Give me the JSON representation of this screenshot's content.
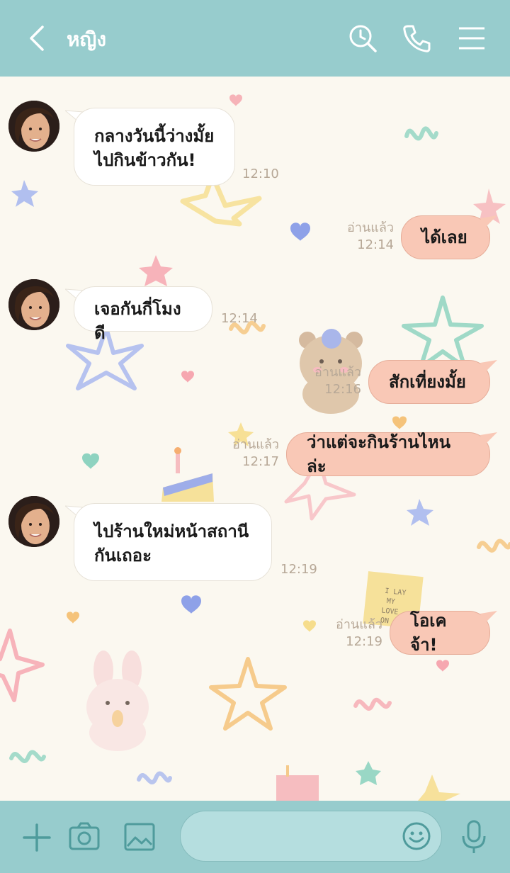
{
  "header": {
    "title": "หญิง"
  },
  "messages": [
    {
      "dir": "in",
      "text_lines": [
        "กลางวันนี้ว่างมั้ย",
        "ไปกินข้าวกัน!"
      ],
      "time": "12:10"
    },
    {
      "dir": "out",
      "text": "ได้เลย",
      "read": "อ่านแล้ว",
      "time": "12:14"
    },
    {
      "dir": "in",
      "text": "เจอกันกี่โมงดี",
      "time": "12:14"
    },
    {
      "dir": "out",
      "text": "สักเที่ยงมั้ย",
      "read": "อ่านแล้ว",
      "time": "12:16"
    },
    {
      "dir": "out",
      "text": "ว่าแต่จะกินร้านไหนล่ะ",
      "read": "อ่านแล้ว",
      "time": "12:17"
    },
    {
      "dir": "in",
      "text_lines": [
        "ไปร้านใหม่หน้าสถานี",
        "กันเถอะ"
      ],
      "time": "12:19"
    },
    {
      "dir": "out",
      "text": "โอเคจ้า!",
      "read": "อ่านแล้ว",
      "time": "12:19"
    }
  ],
  "colors": {
    "header_bg": "#97cccd",
    "chat_bg": "#fbf8f0",
    "incoming_bubble": "#ffffff",
    "outgoing_bubble": "#f9c8b6",
    "input_bar_bg": "#97cccd",
    "input_icon": "#4f9b9c"
  },
  "icons": {
    "back": "chevron-left-icon",
    "search": "clock-search-icon",
    "call": "phone-icon",
    "menu": "hamburger-menu-icon",
    "add": "plus-icon",
    "camera": "camera-icon",
    "image": "image-icon",
    "emoji": "emoji-icon",
    "mic": "microphone-icon"
  }
}
